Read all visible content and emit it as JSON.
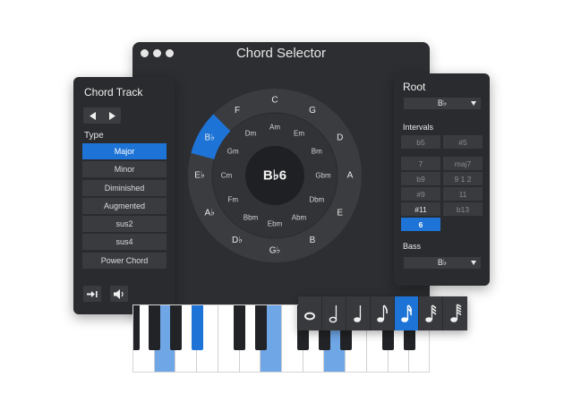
{
  "window": {
    "title": "Chord Selector"
  },
  "wheel": {
    "center": "B♭6",
    "outer": [
      "C",
      "G",
      "D",
      "A",
      "E",
      "B",
      "G♭",
      "D♭",
      "A♭",
      "E♭",
      "B♭",
      "F"
    ],
    "inner": [
      "Am",
      "Em",
      "Bm",
      "Gbm",
      "Dbm",
      "Abm",
      "Ebm",
      "Bbm",
      "Fm",
      "Cm",
      "Gm",
      "Dm"
    ],
    "selected_index": 10,
    "accent": "#1e74d6"
  },
  "chord_track": {
    "title": "Chord Track",
    "type_label": "Type",
    "types": [
      "Major",
      "Minor",
      "Diminished",
      "Augmented",
      "sus2",
      "sus4",
      "Power Chord"
    ],
    "selected_type": "Major"
  },
  "right": {
    "root_label": "Root",
    "root_value": "B♭",
    "intervals_label": "Intervals",
    "intervals": [
      [
        "b5",
        "#5"
      ],
      [
        "7",
        "maj7"
      ],
      [
        "b9",
        "9 1 2"
      ],
      [
        "#9",
        "11"
      ],
      [
        "#11",
        "b13"
      ],
      [
        "6",
        ""
      ]
    ],
    "selected_interval": "6",
    "bass_label": "Bass",
    "bass_value": "B♭"
  },
  "notes": {
    "values": [
      "whole",
      "half",
      "quarter",
      "eighth",
      "sixteenth",
      "thirty-second",
      "sixty-fourth"
    ],
    "selected": "sixteenth"
  },
  "piano": {
    "lit_keys": [
      "F",
      "B♭",
      "D",
      "G"
    ]
  }
}
